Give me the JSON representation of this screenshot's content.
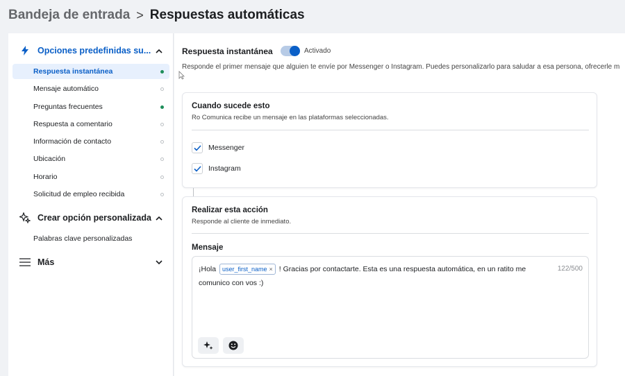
{
  "breadcrumb": {
    "parent": "Bandeja de entrada",
    "separator": ">",
    "current": "Respuestas automáticas"
  },
  "sidebar": {
    "section1": {
      "label": "Opciones predefinidas su...",
      "icon": "bolt-icon",
      "items": [
        {
          "label": "Respuesta instantánea",
          "status": "on"
        },
        {
          "label": "Mensaje automático",
          "status": "off"
        },
        {
          "label": "Preguntas frecuentes",
          "status": "on"
        },
        {
          "label": "Respuesta a comentario",
          "status": "off"
        },
        {
          "label": "Información de contacto",
          "status": "off"
        },
        {
          "label": "Ubicación",
          "status": "off"
        },
        {
          "label": "Horario",
          "status": "off"
        },
        {
          "label": "Solicitud de empleo recibida",
          "status": "off"
        }
      ]
    },
    "section2": {
      "label": "Crear opción personalizada",
      "icon": "sparkle-icon",
      "items": [
        {
          "label": "Palabras clave personalizadas"
        }
      ]
    },
    "section3": {
      "label": "Más",
      "icon": "menu-icon"
    }
  },
  "main": {
    "title": "Respuesta instantánea",
    "toggle_label": "Activado",
    "toggle_on": true,
    "description": "Responde el primer mensaje que alguien te envíe por Messenger o Instagram. Puedes personalizarlo para saludar a esa persona, ofrecerle m",
    "trigger_card": {
      "title": "Cuando sucede esto",
      "subtitle": "Ro Comunica recibe un mensaje en las plataformas seleccionadas.",
      "platforms": [
        {
          "label": "Messenger",
          "checked": true
        },
        {
          "label": "Instagram",
          "checked": true
        }
      ]
    },
    "action_card": {
      "title": "Realizar esta acción",
      "subtitle": "Responde al cliente de inmediato.",
      "message_label": "Mensaje",
      "message_prefix": "¡Hola",
      "variable_chip": "user_first_name",
      "message_suffix": "! Gracias por contactarte. Esta es una respuesta automática, en un ratito me comunico con vos :)",
      "char_count": "122/500"
    }
  },
  "colors": {
    "accent": "#0a5fc7",
    "active_dot": "#1e8e5a",
    "selected_bg": "#e7f0fd"
  }
}
